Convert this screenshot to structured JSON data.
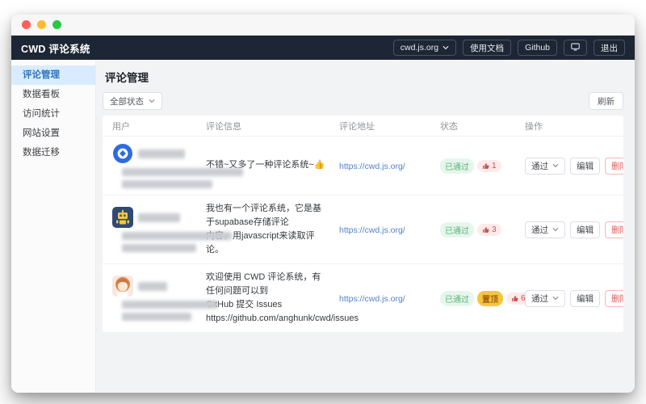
{
  "colors": {
    "header_dark": "#1d2634",
    "accent_blue": "#3274bd",
    "link_blue": "#5282c6",
    "success_green": "#5cb176",
    "pin_gold": "#f3c63e",
    "danger_red": "#e05e5e",
    "traffic_close": "#ff5f57",
    "traffic_minimize": "#febc2e",
    "traffic_zoom": "#28c840"
  },
  "header": {
    "title": "CWD 评论系统",
    "site_select_value": "cwd.js.org",
    "docs_label": "使用文档",
    "github_label": "Github",
    "display_icon": "monitor-icon",
    "logout_label": "退出"
  },
  "sidebar": {
    "items": [
      {
        "label": "评论管理",
        "active": true
      },
      {
        "label": "数据看板",
        "active": false
      },
      {
        "label": "访问统计",
        "active": false
      },
      {
        "label": "网站设置",
        "active": false
      },
      {
        "label": "数据迁移",
        "active": false
      }
    ]
  },
  "main": {
    "page_title": "评论管理",
    "filter_value": "全部状态",
    "refresh_label": "刷新",
    "table": {
      "columns": [
        "用户",
        "评论信息",
        "评论地址",
        "状态",
        "操作"
      ],
      "actions": {
        "approve": "通过",
        "edit": "编辑",
        "delete": "删除"
      },
      "rows": [
        {
          "avatar": "blue-compass-logo",
          "comment": "不错~又多了一种评论系统~👍",
          "url": "https://cwd.js.org/",
          "status": "已通过",
          "likes": "1"
        },
        {
          "avatar": "pixel-robot",
          "comment": "我也有一个评论系统，它是基于supabase存储评论\n内容，用javascript来读取评论。",
          "url": "https://cwd.js.org/",
          "status": "已通过",
          "likes": "3"
        },
        {
          "avatar": "anime-character",
          "comment": "欢迎使用 CWD 评论系统，有任何问题可以到\nGitHub 提交 Issues\nhttps://github.com/anghunk/cwd/issues",
          "url": "https://cwd.js.org/",
          "status": "已通过",
          "pinned_label": "置顶",
          "likes": "6"
        }
      ]
    }
  }
}
